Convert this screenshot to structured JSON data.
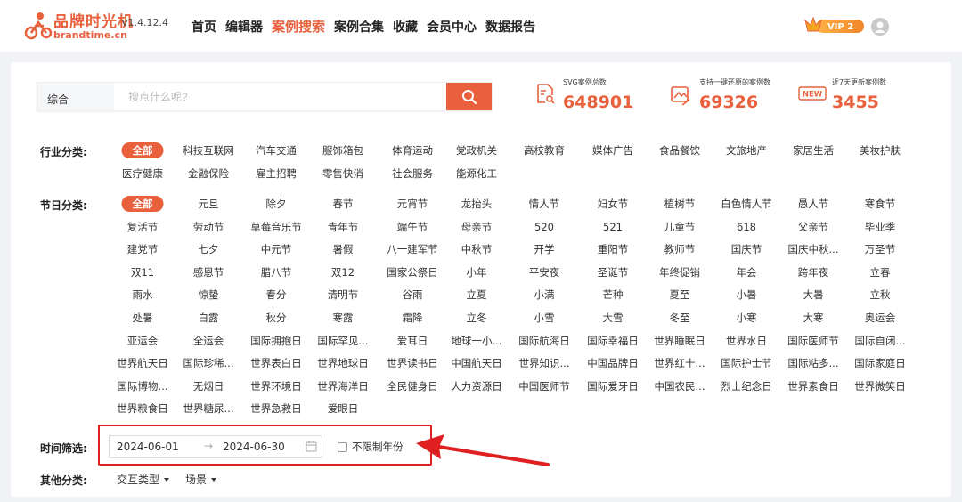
{
  "header": {
    "logo_cn": "品牌时光机",
    "logo_en": "brandtime.cn",
    "version": "v1.4.12.4",
    "nav": [
      "首页",
      "编辑器",
      "案例搜索",
      "案例合集",
      "收藏",
      "会员中心",
      "数据报告"
    ],
    "active_nav": "案例搜索",
    "vip_label": "VIP 2"
  },
  "search": {
    "type": "综合",
    "placeholder": "搜点什么呢?"
  },
  "stats": [
    {
      "label": "SVG案例总数",
      "value": "648901",
      "icon": "document-search-icon"
    },
    {
      "label": "支持一键还原的案例数",
      "value": "69326",
      "icon": "restore-image-icon"
    },
    {
      "label": "近7天更新案例数",
      "value": "3455",
      "icon": "new-badge-icon",
      "badge": "NEW"
    }
  ],
  "filters": {
    "industry_label": "行业分类:",
    "industry": [
      "全部",
      "科技互联网",
      "汽车交通",
      "服饰箱包",
      "体育运动",
      "党政机关",
      "高校教育",
      "媒体广告",
      "食品餐饮",
      "文旅地产",
      "家居生活",
      "美妆护肤",
      "医疗健康",
      "金融保险",
      "雇主招聘",
      "零售快消",
      "社会服务",
      "能源化工"
    ],
    "holiday_label": "节日分类:",
    "holiday": [
      "全部",
      "元旦",
      "除夕",
      "春节",
      "元宵节",
      "龙抬头",
      "情人节",
      "妇女节",
      "植树节",
      "白色情人节",
      "愚人节",
      "寒食节",
      "复活节",
      "劳动节",
      "草莓音乐节",
      "青年节",
      "端午节",
      "母亲节",
      "520",
      "521",
      "儿童节",
      "618",
      "父亲节",
      "毕业季",
      "建党节",
      "七夕",
      "中元节",
      "暑假",
      "八一建军节",
      "中秋节",
      "开学",
      "重阳节",
      "教师节",
      "国庆节",
      "国庆中秋...",
      "万圣节",
      "双11",
      "感恩节",
      "腊八节",
      "双12",
      "国家公祭日",
      "小年",
      "平安夜",
      "圣诞节",
      "年终促销",
      "年会",
      "跨年夜",
      "立春",
      "雨水",
      "惊蛰",
      "春分",
      "清明节",
      "谷雨",
      "立夏",
      "小满",
      "芒种",
      "夏至",
      "小暑",
      "大暑",
      "立秋",
      "处暑",
      "白露",
      "秋分",
      "寒露",
      "霜降",
      "立冬",
      "小雪",
      "大雪",
      "冬至",
      "小寒",
      "大寒",
      "奥运会",
      "亚运会",
      "全运会",
      "国际拥抱日",
      "国际罕见...",
      "爱耳日",
      "地球一小...",
      "国际航海日",
      "国际幸福日",
      "世界睡眠日",
      "世界水日",
      "国际医师节",
      "国际自闭...",
      "世界航天日",
      "国际珍稀...",
      "世界表白日",
      "世界地球日",
      "世界读书日",
      "中国航天日",
      "世界知识...",
      "中国品牌日",
      "世界红十...",
      "国际护士节",
      "国际粘多...",
      "国际家庭日",
      "国际博物...",
      "无烟日",
      "世界环境日",
      "世界海洋日",
      "全民健身日",
      "人力资源日",
      "中国医师节",
      "国际爱牙日",
      "中国农民...",
      "烈士纪念日",
      "世界素食日",
      "世界微笑日",
      "世界粮食日",
      "世界糖尿...",
      "世界急救日",
      "爱眼日"
    ],
    "time_label": "时间筛选:",
    "date_start": "2024-06-01",
    "date_arrow": "→",
    "date_end": "2024-06-30",
    "no_year_limit": "不限制年份",
    "other_label": "其他分类:",
    "dropdowns": [
      "交互类型",
      "场景"
    ]
  },
  "colors": {
    "accent": "#e8603c",
    "annotation": "#e02020"
  }
}
